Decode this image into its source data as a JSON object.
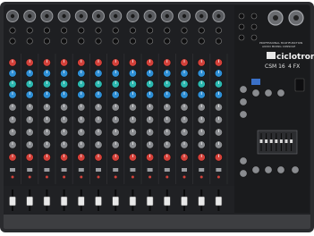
{
  "mixer": {
    "brand": "ciclotron",
    "model": "CSM 16",
    "model_suffix": "4 FX",
    "tagline_1": "PROFESSIONAL MULTIFUNCTION",
    "tagline_2": "AUDIO MIXING CONSOLE",
    "channel_count": 13,
    "knob_rows_per_channel": 9
  },
  "colors": {
    "body": "#2a2b2e",
    "panel": "#1b1c1e",
    "frame": "#3a3b3e",
    "knob_red": "#d4413a",
    "knob_blue": "#2e8fd6",
    "knob_teal": "#2bb8b0",
    "knob_grey": "#8a8c90",
    "fader_cap": "#e8e8e8",
    "fader_blue": "#3a6fd6",
    "fader_yellow": "#e0c020"
  }
}
